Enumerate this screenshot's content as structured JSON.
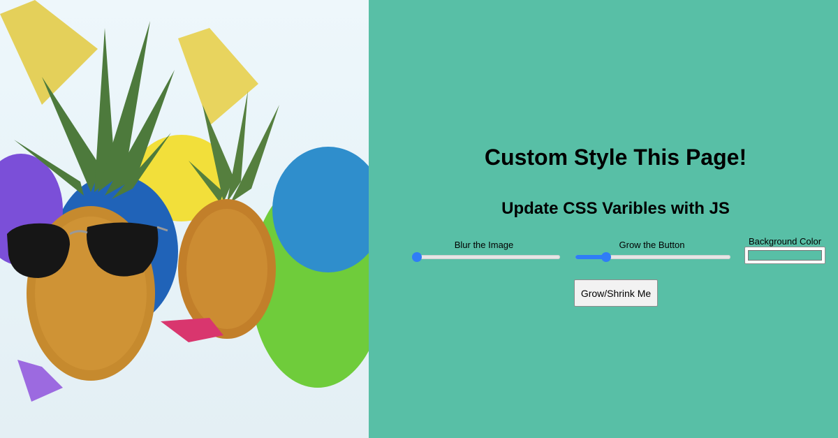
{
  "photo": {
    "alt_subject": "pineapples with party hats and sunglasses",
    "blur_value": 0
  },
  "heading": {
    "title": "Custom Style This Page!",
    "subtitle": "Update CSS Varibles with JS"
  },
  "controls": {
    "blur": {
      "label": "Blur the Image",
      "value": 0.02
    },
    "grow": {
      "label": "Grow the Button",
      "value": 0.2
    },
    "background": {
      "label": "Background Color",
      "value": "#58bfa6"
    }
  },
  "button": {
    "label": "Grow/Shrink Me"
  },
  "colors": {
    "page_background": "#58bfa6",
    "slider_accent": "#2f7df6",
    "button_background": "#f2f2f2"
  }
}
